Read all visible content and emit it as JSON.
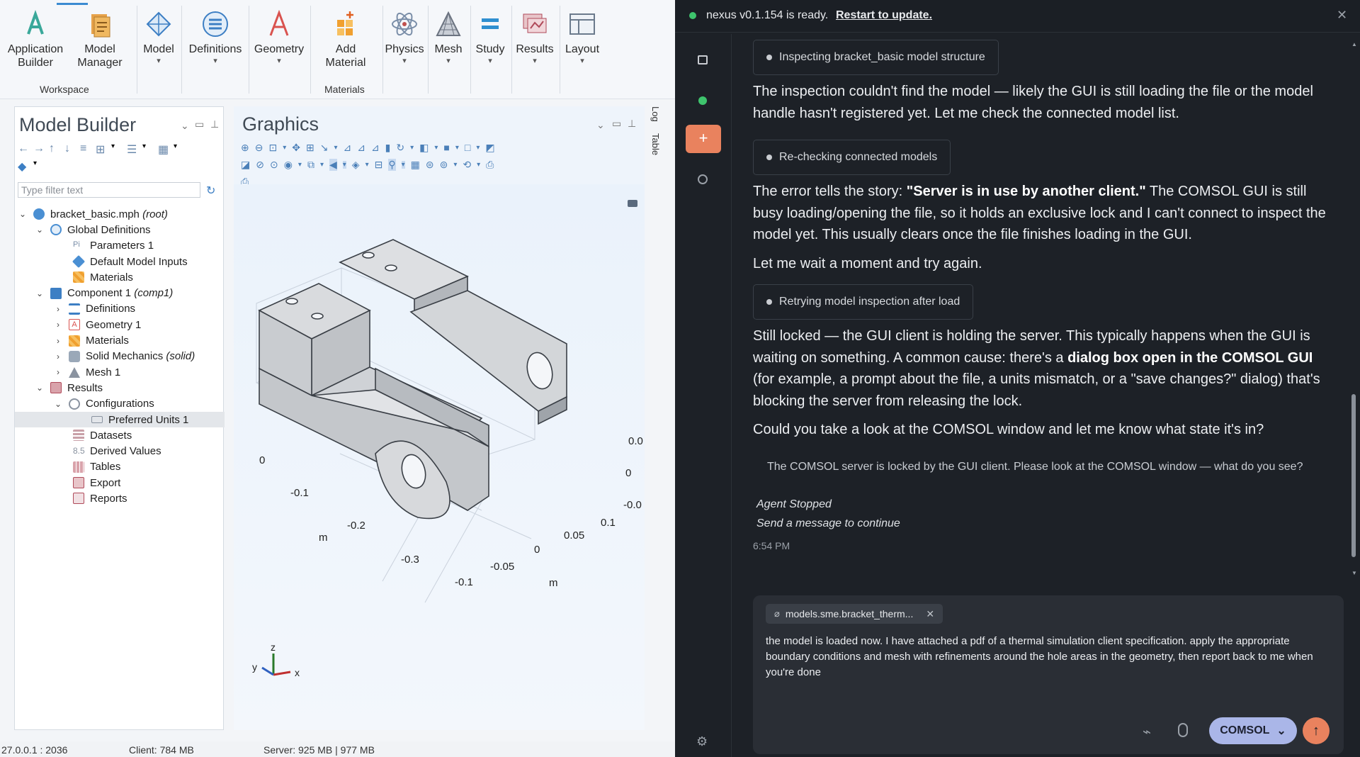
{
  "ribbon": {
    "buttons": [
      {
        "label": "Application\nBuilder"
      },
      {
        "label": "Model\nManager"
      },
      {
        "label": "Model"
      },
      {
        "label": "Definitions"
      },
      {
        "label": "Geometry"
      },
      {
        "label": "Add\nMaterial"
      },
      {
        "label": "Physics"
      },
      {
        "label": "Mesh"
      },
      {
        "label": "Study"
      },
      {
        "label": "Results"
      },
      {
        "label": "Layout"
      }
    ],
    "groups": {
      "workspace": "Workspace",
      "materials": "Materials"
    }
  },
  "model_builder": {
    "title": "Model Builder",
    "filter_placeholder": "Type filter text",
    "tree": [
      {
        "label": "bracket_basic.mph",
        "suffix": "(root)"
      },
      {
        "label": "Global Definitions",
        "suffix": ""
      },
      {
        "label": "Parameters 1",
        "suffix": ""
      },
      {
        "label": "Default Model Inputs",
        "suffix": ""
      },
      {
        "label": "Materials",
        "suffix": ""
      },
      {
        "label": "Component 1",
        "suffix": "(comp1)"
      },
      {
        "label": "Definitions",
        "suffix": ""
      },
      {
        "label": "Geometry 1",
        "suffix": ""
      },
      {
        "label": "Materials",
        "suffix": ""
      },
      {
        "label": "Solid Mechanics",
        "suffix": "(solid)"
      },
      {
        "label": "Mesh 1",
        "suffix": ""
      },
      {
        "label": "Results",
        "suffix": ""
      },
      {
        "label": "Configurations",
        "suffix": ""
      },
      {
        "label": "Preferred Units 1",
        "suffix": ""
      },
      {
        "label": "Datasets",
        "suffix": ""
      },
      {
        "label": "Derived Values",
        "suffix": ""
      },
      {
        "label": "Tables",
        "suffix": ""
      },
      {
        "label": "Export",
        "suffix": ""
      },
      {
        "label": "Reports",
        "suffix": ""
      }
    ]
  },
  "graphics": {
    "title": "Graphics",
    "axis_labels": {
      "left_zero": "0",
      "m_left": "m",
      "t1": "-0.1",
      "t2": "-0.2",
      "t3": "-0.3",
      "b1": "-0.1",
      "b2": "-0.05",
      "b3": "0",
      "b4": "0.05",
      "b5": "0.1",
      "m_bottom": "m",
      "r1": "0.0",
      "r2": "0",
      "r3": "-0.0"
    },
    "triad": {
      "x": "x",
      "y": "y",
      "z": "z"
    }
  },
  "side_tabs": {
    "log": "Log",
    "table": "Table"
  },
  "status_bar": {
    "version": "27.0.0.1 : 2036",
    "client": "Client: 784 MB",
    "server": "Server: 925 MB | 977 MB"
  },
  "agent": {
    "banner": {
      "text": "nexus v0.1.154 is ready.",
      "link": "Restart to update."
    },
    "messages": {
      "pill1": "Inspecting bracket_basic model structure",
      "p1": "The inspection couldn't find the model — likely the GUI is still loading the file or the model handle hasn't registered yet. Let me check the connected model list.",
      "pill2": "Re-checking connected models",
      "p2a": "The error tells the story: ",
      "p2b": "\"Server is in use by another client.\"",
      "p2c": " The COMSOL GUI is still busy loading/opening the file, so it holds an exclusive lock and I can't connect to inspect the model yet. This usually clears once the file finishes loading in the GUI.",
      "p3": "Let me wait a moment and try again.",
      "pill3": "Retrying model inspection after load",
      "p4a": "Still locked — the GUI client is holding the server. This typically happens when the GUI is waiting on something. A common cause: there's a ",
      "p4b": "dialog box open in the COMSOL GUI",
      "p4c": " (for example, a prompt about the file, a units mismatch, or a \"save changes?\" dialog) that's blocking the server from releasing the lock.",
      "p5": "Could you take a look at the COMSOL window and let me know what state it's in?",
      "note": "The COMSOL server is locked by the GUI client. Please look at the COMSOL window — what do you see?",
      "stopped1": "Agent Stopped",
      "stopped2": "Send a message to continue",
      "time": "6:54 PM"
    },
    "composer": {
      "attachment": "models.sme.bracket_therm...",
      "text": "the model is loaded now. I have attached a pdf of a thermal simulation client specification. apply the appropriate boundary conditions and mesh with refinements around the hole areas in the geometry, then report back to me when you're done",
      "mode": "COMSOL"
    }
  }
}
